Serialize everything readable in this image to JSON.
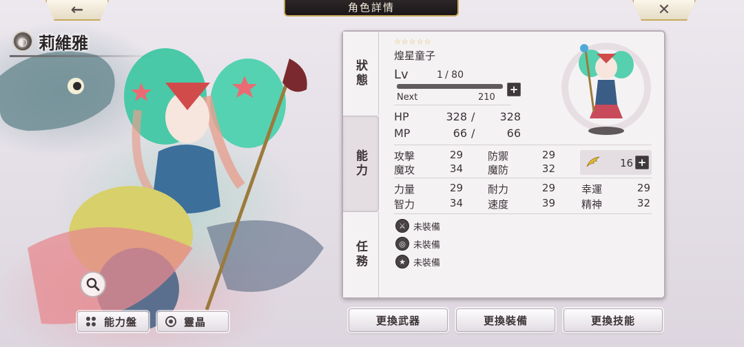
{
  "header": {
    "title": "角色詳情",
    "back_icon": "←",
    "close_icon": "✕"
  },
  "character": {
    "name": "莉維雅",
    "element_icon": "◐"
  },
  "tabs": [
    {
      "label": "狀態"
    },
    {
      "label": "能力"
    },
    {
      "label": "任務"
    }
  ],
  "status": {
    "stars": "☆☆☆☆☆",
    "title": "煌星童子",
    "lv_label": "Lv",
    "lv": "1",
    "lv_max": "/ 80",
    "next_label": "Next",
    "next_value": "210",
    "hp_label": "HP",
    "hp_current": "328",
    "hp_sep": "/",
    "hp_max": "328",
    "mp_label": "MP",
    "mp_current": "66",
    "mp_sep": "/",
    "mp_max": "66"
  },
  "attributes": {
    "attack_label": "攻擊",
    "attack": "29",
    "defense_label": "防禦",
    "defense": "29",
    "magic_atk_label": "魔攻",
    "magic_atk": "34",
    "magic_def_label": "魔防",
    "magic_def": "32",
    "power_label": "力量",
    "power": "29",
    "stamina_label": "耐力",
    "stamina": "29",
    "luck_label": "幸運",
    "luck": "29",
    "intellect_label": "智力",
    "intellect": "34",
    "speed_label": "速度",
    "speed": "39",
    "spirit_label": "精神",
    "spirit": "32"
  },
  "wing": {
    "icon": "wing-icon",
    "value": "16"
  },
  "equipment": [
    {
      "label": "未裝備"
    },
    {
      "label": "未裝備"
    },
    {
      "label": "未裝備"
    }
  ],
  "left_buttons": {
    "board": "能力盤",
    "crystal": "靈晶"
  },
  "actions": {
    "weapon": "更換武器",
    "gear": "更換裝備",
    "skill": "更換技能"
  }
}
